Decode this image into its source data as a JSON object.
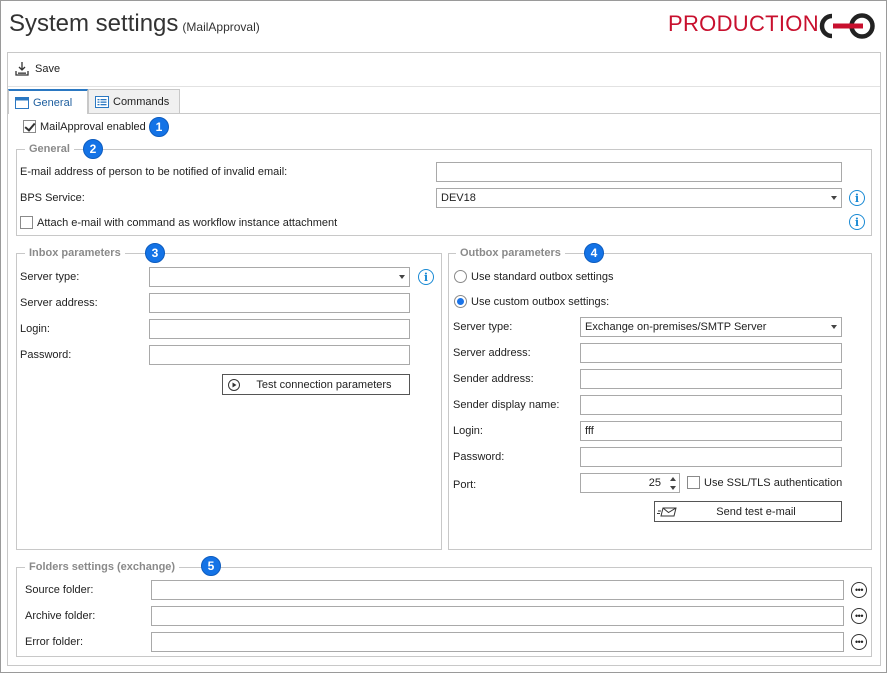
{
  "header": {
    "title": "System settings",
    "subtitle": "(MailApproval)",
    "environment": "PRODUCTION",
    "environment_color": "#c8102e"
  },
  "toolbar": {
    "save_label": "Save",
    "save_icon": "save-download-icon"
  },
  "tabs": [
    {
      "label": "General",
      "icon": "window-icon",
      "active": true
    },
    {
      "label": "Commands",
      "icon": "list-icon",
      "active": false
    }
  ],
  "mailapproval_enabled": {
    "label": "MailApproval enabled",
    "checked": true,
    "badge": "1"
  },
  "general": {
    "legend": "General",
    "badge": "2",
    "email_label": "E-mail address of person to be notified of invalid email:",
    "email_value": "",
    "bps_label": "BPS Service:",
    "bps_value": "DEV18",
    "attach_label": "Attach e-mail with command as workflow instance attachment",
    "attach_checked": false
  },
  "inbox": {
    "legend": "Inbox parameters",
    "badge": "3",
    "server_type_label": "Server type:",
    "server_type_value": "",
    "server_address_label": "Server address:",
    "server_address_value": "",
    "login_label": "Login:",
    "login_value": "",
    "password_label": "Password:",
    "password_value": "",
    "test_button": "Test connection parameters"
  },
  "outbox": {
    "legend": "Outbox parameters",
    "badge": "4",
    "standard_label": "Use standard outbox settings",
    "custom_label": "Use custom outbox settings:",
    "selected": "custom",
    "server_type_label": "Server type:",
    "server_type_value": "Exchange on-premises/SMTP Server",
    "server_address_label": "Server address:",
    "server_address_value": "",
    "sender_address_label": "Sender address:",
    "sender_address_value": "",
    "sender_display_label": "Sender display name:",
    "sender_display_value": "",
    "login_label": "Login:",
    "login_value": "fff",
    "password_label": "Password:",
    "password_value": "",
    "port_label": "Port:",
    "port_value": "25",
    "ssl_label": "Use SSL/TLS authentication",
    "ssl_checked": false,
    "send_test_button": "Send test e-mail"
  },
  "folders": {
    "legend": "Folders settings (exchange)",
    "badge": "5",
    "source_label": "Source folder:",
    "source_value": "",
    "archive_label": "Archive folder:",
    "archive_value": "",
    "error_label": "Error folder:",
    "error_value": ""
  },
  "colors": {
    "accent": "#1473e6",
    "info": "#1a8ad4",
    "tab_active": "#2b78c2"
  }
}
